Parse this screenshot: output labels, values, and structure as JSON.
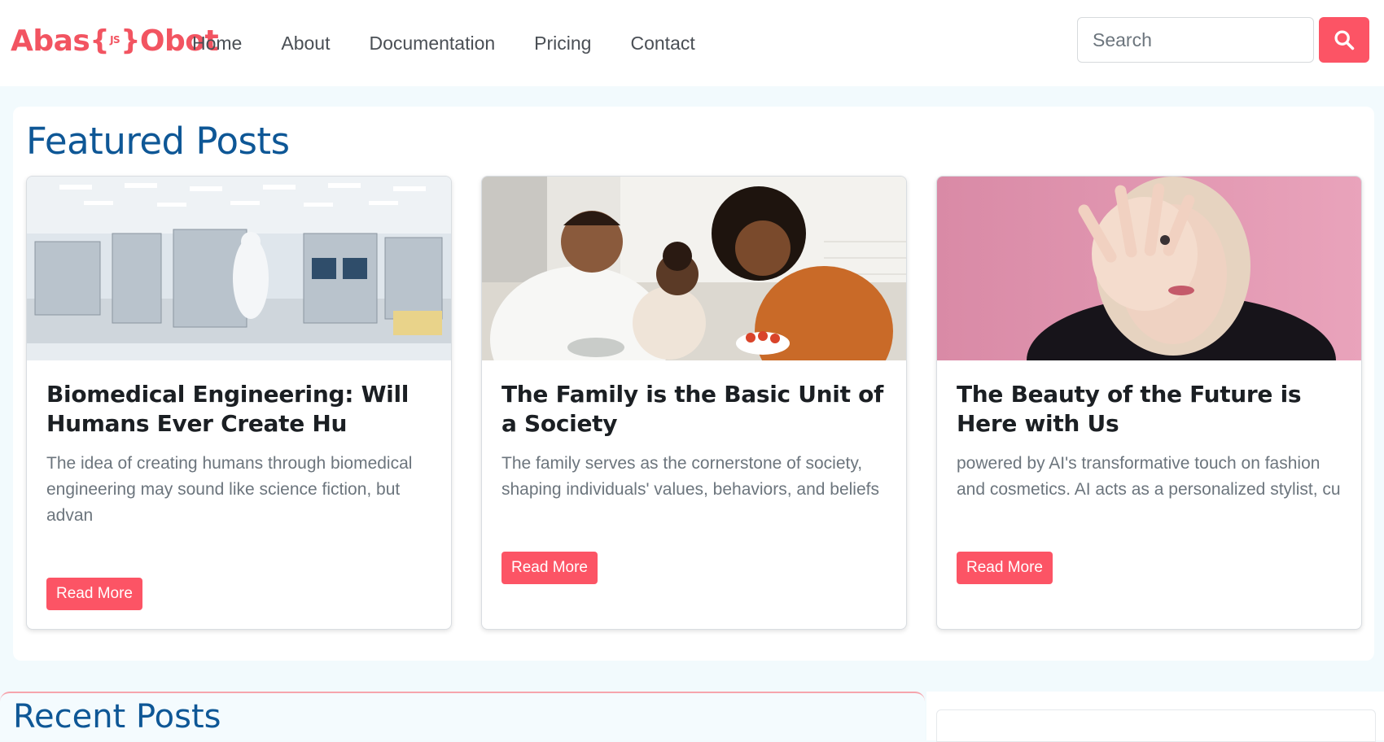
{
  "brand": {
    "left": "Abas",
    "brace_open": "{",
    "js": "JS",
    "brace_close": "}",
    "right": "Obot"
  },
  "nav": {
    "items": [
      "Home",
      "About",
      "Documentation",
      "Pricing",
      "Contact"
    ]
  },
  "search": {
    "placeholder": "Search",
    "value": ""
  },
  "featured": {
    "title": "Featured Posts",
    "cards": [
      {
        "title": "Biomedical Engineering: Will Humans Ever Create Hu",
        "text": "The idea of creating humans through biomedical engineering may sound like science fiction, but advan",
        "button": "Read More"
      },
      {
        "title": "The Family is the Basic Unit of a Society",
        "text": "The family serves as the cornerstone of society, shaping individuals' values, behaviors, and beliefs",
        "button": "Read More"
      },
      {
        "title": "The Beauty of the Future is Here with Us",
        "text": "powered by AI's transformative touch on fashion and cosmetics. AI acts as a personalized stylist, cu",
        "button": "Read More"
      }
    ]
  },
  "recent": {
    "title": "Recent Posts"
  },
  "colors": {
    "accent": "#fc5465",
    "heading": "#0e5796",
    "page_bg": "#f2fafd"
  }
}
